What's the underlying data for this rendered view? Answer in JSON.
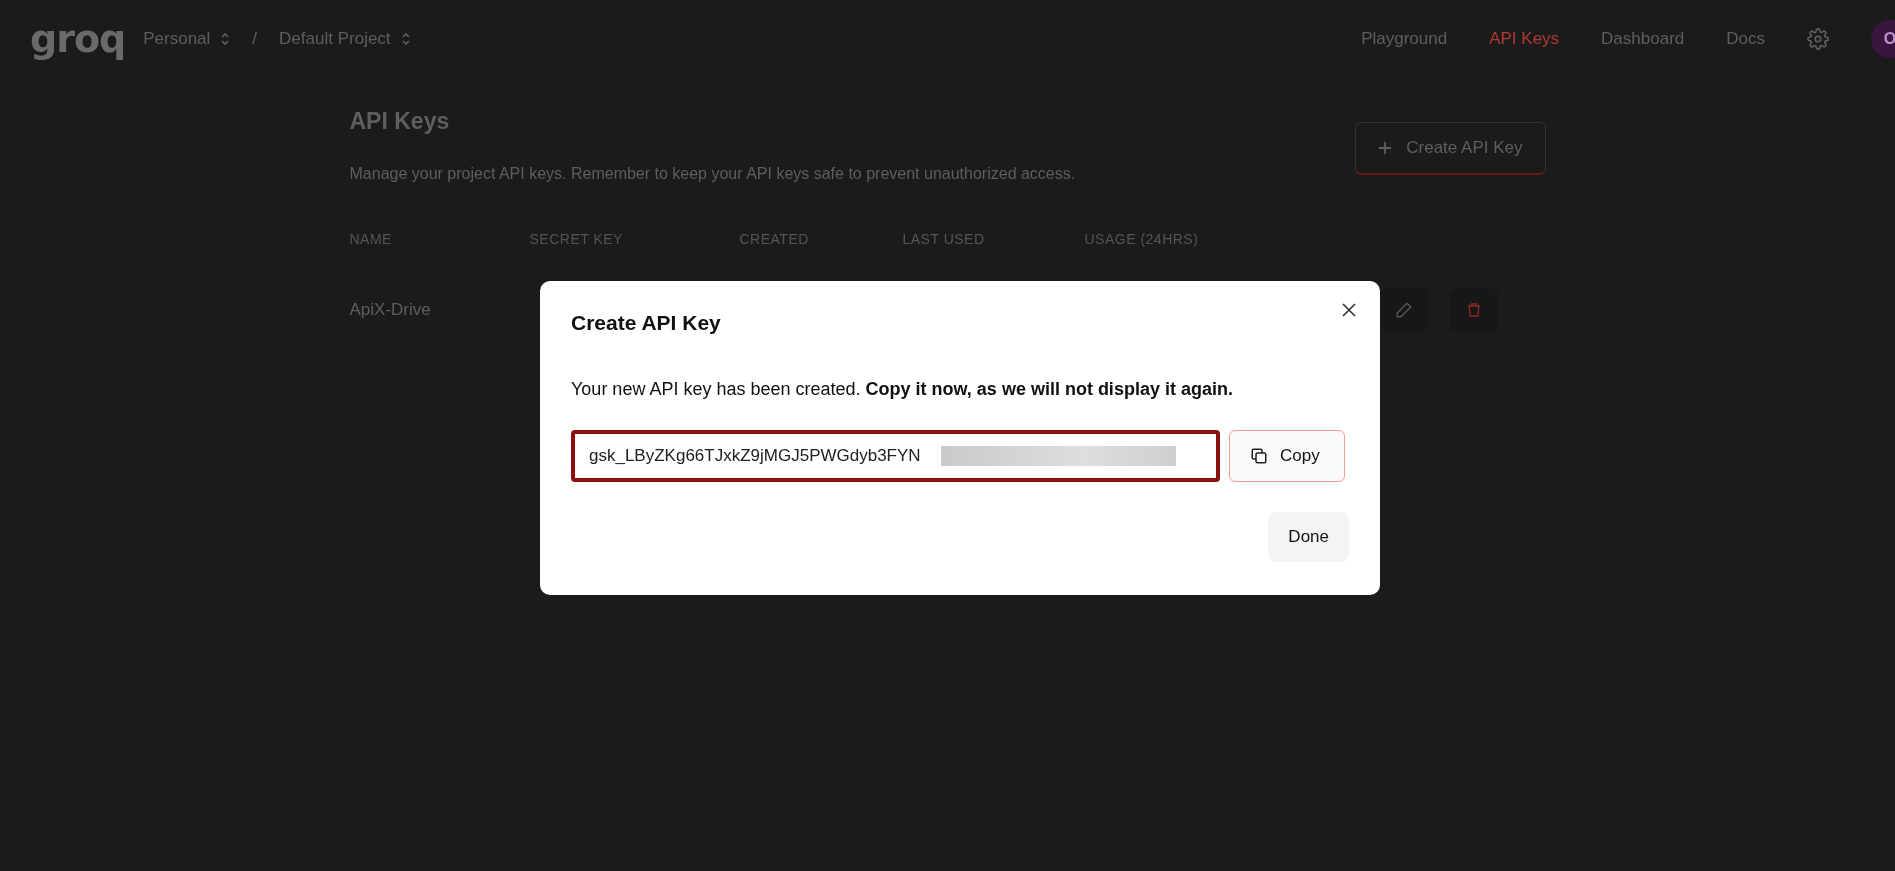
{
  "header": {
    "logo": "groq",
    "org": "Personal",
    "separator": "/",
    "project": "Default Project",
    "nav": [
      {
        "label": "Playground",
        "selected": false
      },
      {
        "label": "API Keys",
        "selected": true
      },
      {
        "label": "Dashboard",
        "selected": false
      },
      {
        "label": "Docs",
        "selected": false
      }
    ],
    "avatar": "O"
  },
  "page": {
    "title": "API Keys",
    "description": "Manage your project API keys. Remember to keep your API keys safe to prevent unauthorized access.",
    "create_button": "Create API Key",
    "table": {
      "columns": [
        "NAME",
        "SECRET KEY",
        "CREATED",
        "LAST USED",
        "USAGE (24HRS)"
      ],
      "rows": [
        {
          "name": "ApiX-Drive"
        }
      ]
    }
  },
  "dialog": {
    "title": "Create API Key",
    "message": "Your new API key has been created. **Copy it now, as we will not display it again.**",
    "key_value": "gsk_LByZKg66TJxkZ9jMGJ5PWGdyb3FYN",
    "copy_button": "Copy",
    "done_button": "Done"
  }
}
